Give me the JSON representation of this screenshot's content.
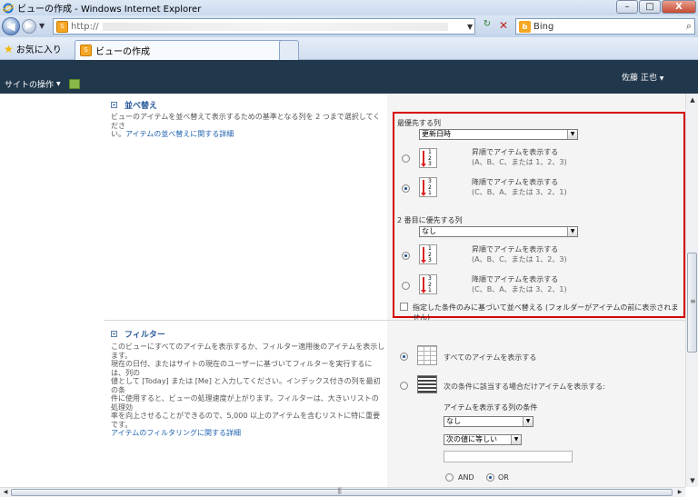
{
  "window": {
    "title": "ビューの作成 - Windows Internet Explorer",
    "minimize_label": "–",
    "maximize_label": "□",
    "close_label": "X"
  },
  "address_bar": {
    "url_prefix": "http://",
    "search_engine": "Bing"
  },
  "favorites": {
    "label": "お気に入り",
    "tab_title": "ビューの作成"
  },
  "header": {
    "site_actions": "サイトの操作",
    "user": "佐藤 正也"
  },
  "sort_section": {
    "title": "並べ替え",
    "description_line1": "ビューのアイテムを並べ替えて表示するための基準となる列を 2 つまで選択してくださ",
    "description_line2_prefix": "い。",
    "help_link": "アイテムの並べ替えに関する詳細",
    "first_label": "最優先する列",
    "first_value": "更新日時",
    "second_label": "2 番目に優先する列",
    "second_value": "なし",
    "asc_title": "昇順でアイテムを表示する",
    "asc_sub": "(A、B、C、または 1、2、3)",
    "desc_title": "降順でアイテムを表示する",
    "desc_sub": "(C、B、A、または 3、2、1)",
    "asc_nums": "1\n2\n3",
    "desc_nums": "3\n2\n1",
    "only_fields_label": "指定した条件のみに基づいて並べ替える (フォルダーがアイテムの前に表示されません)",
    "first_order": "descending",
    "second_order": "ascending"
  },
  "filter_section": {
    "title": "フィルター",
    "desc_lines": [
      "このビューにすべてのアイテムを表示するか、フィルター適用後のアイテムを表示します。",
      "現在の日付、またはサイトの現在のユーザーに基づいてフィルターを実行するには、列の",
      "値として [Today] または [Me] と入力してください。インデックス付きの列を最初の条",
      "件に使用すると、ビューの処理速度が上がります。フィルターは、大きいリストの処理効",
      "率を向上させることができるので、5,000 以上のアイテムを含むリストに特に重要です。"
    ],
    "help_link": "アイテムのフィルタリングに関する詳細",
    "show_all": "すべてのアイテムを表示する",
    "show_filtered": "次の条件に該当する場合だけアイテムを表示する:",
    "column_label": "アイテムを表示する列の条件",
    "column_value": "なし",
    "operator_value": "次の値に等しい",
    "and_label": "AND",
    "or_label": "OR"
  }
}
